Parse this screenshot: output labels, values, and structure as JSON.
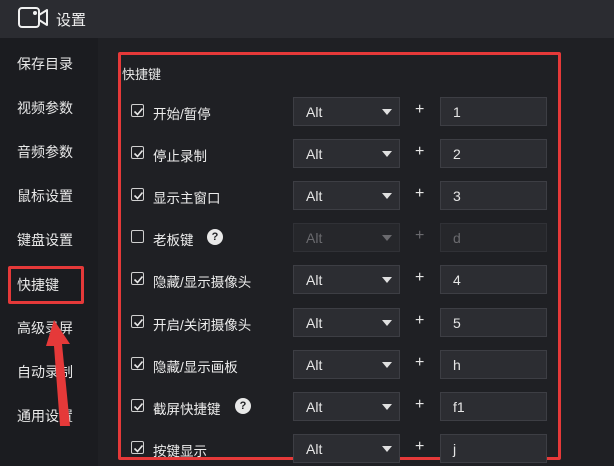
{
  "window": {
    "title": "设置"
  },
  "sidebar": {
    "items": [
      {
        "label": "保存目录"
      },
      {
        "label": "视频参数"
      },
      {
        "label": "音频参数"
      },
      {
        "label": "鼠标设置"
      },
      {
        "label": "键盘设置"
      },
      {
        "label": "快捷键",
        "active": true
      },
      {
        "label": "高级录屏"
      },
      {
        "label": "自动录制"
      },
      {
        "label": "通用设置"
      }
    ]
  },
  "shortcuts": {
    "section_title": "快捷键",
    "plus": "+",
    "rows": [
      {
        "label": "开始/暂停",
        "checked": true,
        "modifier": "Alt",
        "key": "1"
      },
      {
        "label": "停止录制",
        "checked": true,
        "modifier": "Alt",
        "key": "2"
      },
      {
        "label": "显示主窗口",
        "checked": true,
        "modifier": "Alt",
        "key": "3"
      },
      {
        "label": "老板键",
        "checked": false,
        "help": "?",
        "modifier": "Alt",
        "key": "d",
        "disabled": true
      },
      {
        "label": "隐藏/显示摄像头",
        "checked": true,
        "modifier": "Alt",
        "key": "4"
      },
      {
        "label": "开启/关闭摄像头",
        "checked": true,
        "modifier": "Alt",
        "key": "5"
      },
      {
        "label": "隐藏/显示画板",
        "checked": true,
        "modifier": "Alt",
        "key": "h"
      },
      {
        "label": "截屏快捷键",
        "checked": true,
        "help": "?",
        "modifier": "Alt",
        "key": "f1"
      },
      {
        "label": "按键显示",
        "checked": true,
        "modifier": "Alt",
        "key": "j"
      }
    ]
  },
  "colors": {
    "highlight": "#e53939",
    "background": "#1f2024",
    "sidebar": "#1b1c20"
  }
}
